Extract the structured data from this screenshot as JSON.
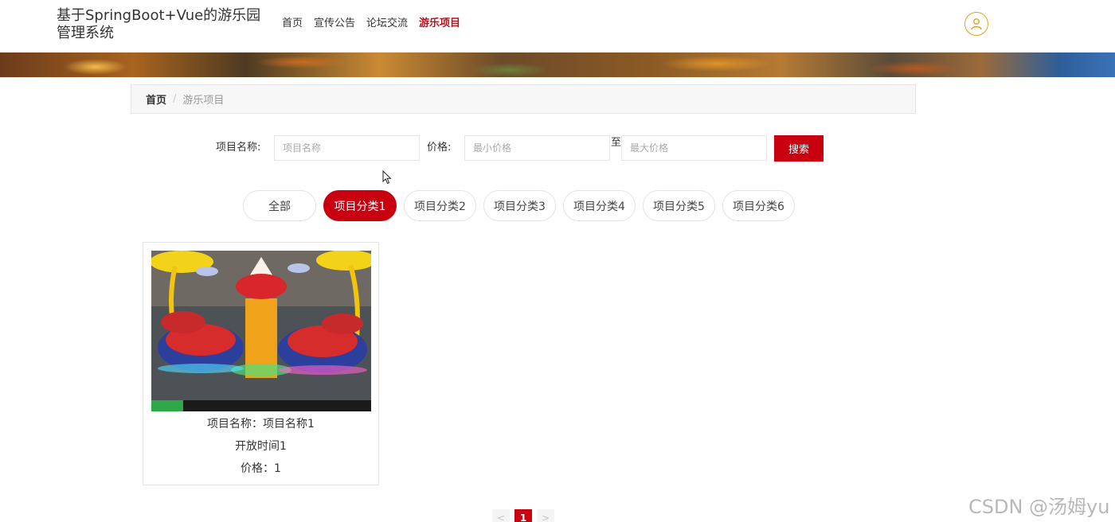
{
  "header": {
    "site_title": "基于SpringBoot+Vue的游乐园管理系统",
    "nav": [
      {
        "label": "首页",
        "active": false
      },
      {
        "label": "宣传公告",
        "active": false
      },
      {
        "label": "论坛交流",
        "active": false
      },
      {
        "label": "游乐项目",
        "active": true
      }
    ],
    "avatar_icon": "user-icon"
  },
  "breadcrumb": {
    "home": "首页",
    "separator": "/",
    "current": "游乐项目"
  },
  "search": {
    "name_label": "项目名称:",
    "name_placeholder": "项目名称",
    "name_value": "",
    "price_label": "价格:",
    "min_placeholder": "最小价格",
    "max_placeholder": "最大价格",
    "range_separator": "至",
    "button_label": "搜索"
  },
  "categories": [
    {
      "label": "全部",
      "active": false
    },
    {
      "label": "项目分类1",
      "active": true
    },
    {
      "label": "项目分类2",
      "active": false
    },
    {
      "label": "项目分类3",
      "active": false
    },
    {
      "label": "项目分类4",
      "active": false
    },
    {
      "label": "项目分类5",
      "active": false
    },
    {
      "label": "项目分类6",
      "active": false
    }
  ],
  "items": [
    {
      "name_line": "项目名称：项目名称1",
      "open_time": "开放时间1",
      "price_line": "价格：1",
      "image": "amusement-ride-photo"
    }
  ],
  "pagination": {
    "prev": "<",
    "current": "1",
    "next": ">"
  },
  "watermark": "CSDN @汤姆yu",
  "colors": {
    "accent": "#c8000f",
    "nav_active": "#b8101a",
    "avatar_ring": "#e0a020"
  }
}
